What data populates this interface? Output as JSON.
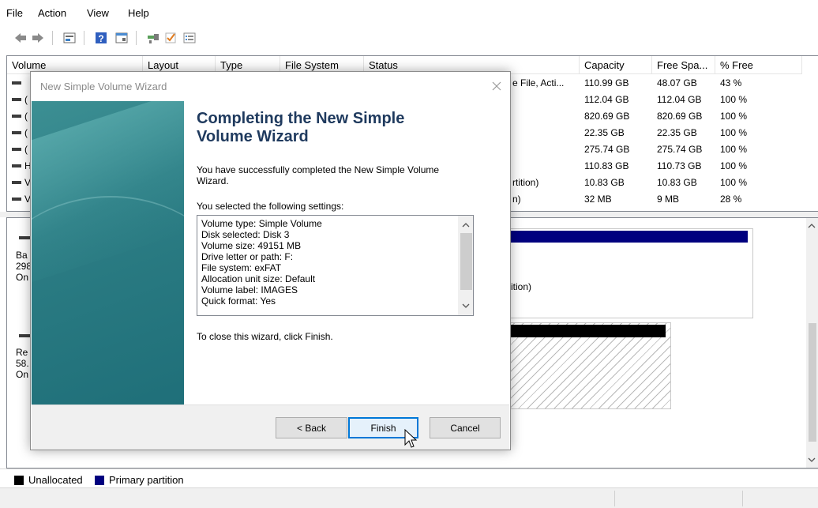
{
  "menu": {
    "file": "File",
    "action": "Action",
    "view": "View",
    "help": "Help"
  },
  "toolbar": {
    "icons": [
      "back-arrow-icon",
      "forward-arrow-icon",
      "disk-list-icon",
      "help-icon",
      "properties-icon",
      "connect-icon",
      "check-icon",
      "list-view-icon"
    ]
  },
  "volume_list": {
    "headers": [
      "Volume",
      "Layout",
      "Type",
      "File System",
      "Status",
      "Capacity",
      "Free Spa...",
      "% Free"
    ],
    "rows": [
      {
        "volume": "",
        "status": "e File, Acti...",
        "capacity": "110.99 GB",
        "free": "48.07 GB",
        "pct": "43 %"
      },
      {
        "volume": "(",
        "status": "",
        "capacity": "112.04 GB",
        "free": "112.04 GB",
        "pct": "100 %"
      },
      {
        "volume": "(",
        "status": "",
        "capacity": "820.69 GB",
        "free": "820.69 GB",
        "pct": "100 %"
      },
      {
        "volume": "(",
        "status": "",
        "capacity": "22.35 GB",
        "free": "22.35 GB",
        "pct": "100 %"
      },
      {
        "volume": "(",
        "status": "",
        "capacity": "275.74 GB",
        "free": "275.74 GB",
        "pct": "100 %"
      },
      {
        "volume": "H",
        "status": "",
        "capacity": "110.83 GB",
        "free": "110.73 GB",
        "pct": "100 %"
      },
      {
        "volume": "V",
        "status": "rtition)",
        "capacity": "10.83 GB",
        "free": "10.83 GB",
        "pct": "100 %"
      },
      {
        "volume": "V",
        "status": "n)",
        "capacity": "32 MB",
        "free": "9 MB",
        "pct": "28 %"
      }
    ]
  },
  "disks": {
    "disk_a": {
      "line1": "Ba",
      "line2": "298",
      "line3": "On",
      "partition_label": "ition)"
    },
    "disk_b": {
      "line1": "Re",
      "line2": "58.",
      "line3": "On"
    }
  },
  "legend": {
    "unallocated": "Unallocated",
    "primary": "Primary partition"
  },
  "colors": {
    "primary_partition": "#00007f",
    "unallocated": "#000000",
    "wizard_heading": "#1f3a5e",
    "focus_border": "#0078d7"
  },
  "dialog": {
    "title": "New Simple Volume Wizard",
    "heading": "Completing the New Simple Volume Wizard",
    "success_text": "You have successfully completed the New Simple Volume Wizard.",
    "settings_label": "You selected the following settings:",
    "settings": [
      "Volume type: Simple Volume",
      "Disk selected: Disk 3",
      "Volume size: 49151 MB",
      "Drive letter or path: F:",
      "File system: exFAT",
      "Allocation unit size: Default",
      "Volume label: IMAGES",
      "Quick format: Yes"
    ],
    "close_text": "To close this wizard, click Finish.",
    "buttons": {
      "back": "< Back",
      "finish": "Finish",
      "cancel": "Cancel"
    }
  }
}
